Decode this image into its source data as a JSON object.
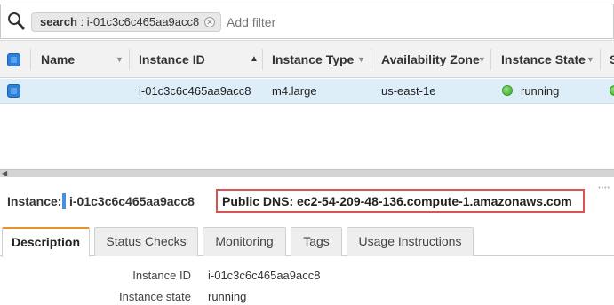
{
  "search": {
    "chip_key": "search",
    "chip_value": "i-01c3c6c465aa9acc8",
    "add_filter_placeholder": "Add filter"
  },
  "table": {
    "columns": [
      "Name",
      "Instance ID",
      "Instance Type",
      "Availability Zone",
      "Instance State",
      "S"
    ],
    "rows": [
      {
        "name": "",
        "instance_id": "i-01c3c6c465aa9acc8",
        "instance_type": "m4.large",
        "availability_zone": "us-east-1e",
        "instance_state": "running",
        "state_color": "#3ea82a"
      }
    ]
  },
  "detail": {
    "instance_label": "Instance:",
    "instance_id": "i-01c3c6c465aa9acc8",
    "public_dns": "Public DNS: ec2-54-209-48-136.compute-1.amazonaws.com",
    "tabs": [
      "Description",
      "Status Checks",
      "Monitoring",
      "Tags",
      "Usage Instructions"
    ],
    "active_tab": "Description",
    "fields": [
      {
        "label": "Instance ID",
        "value": "i-01c3c6c465aa9acc8"
      },
      {
        "label": "Instance state",
        "value": "running"
      }
    ]
  },
  "colors": {
    "selected_row": "#ddeef9",
    "highlight_box": "#d9534f",
    "active_tab_accent": "#e8912c",
    "checkbox": "#2f7fd6"
  }
}
